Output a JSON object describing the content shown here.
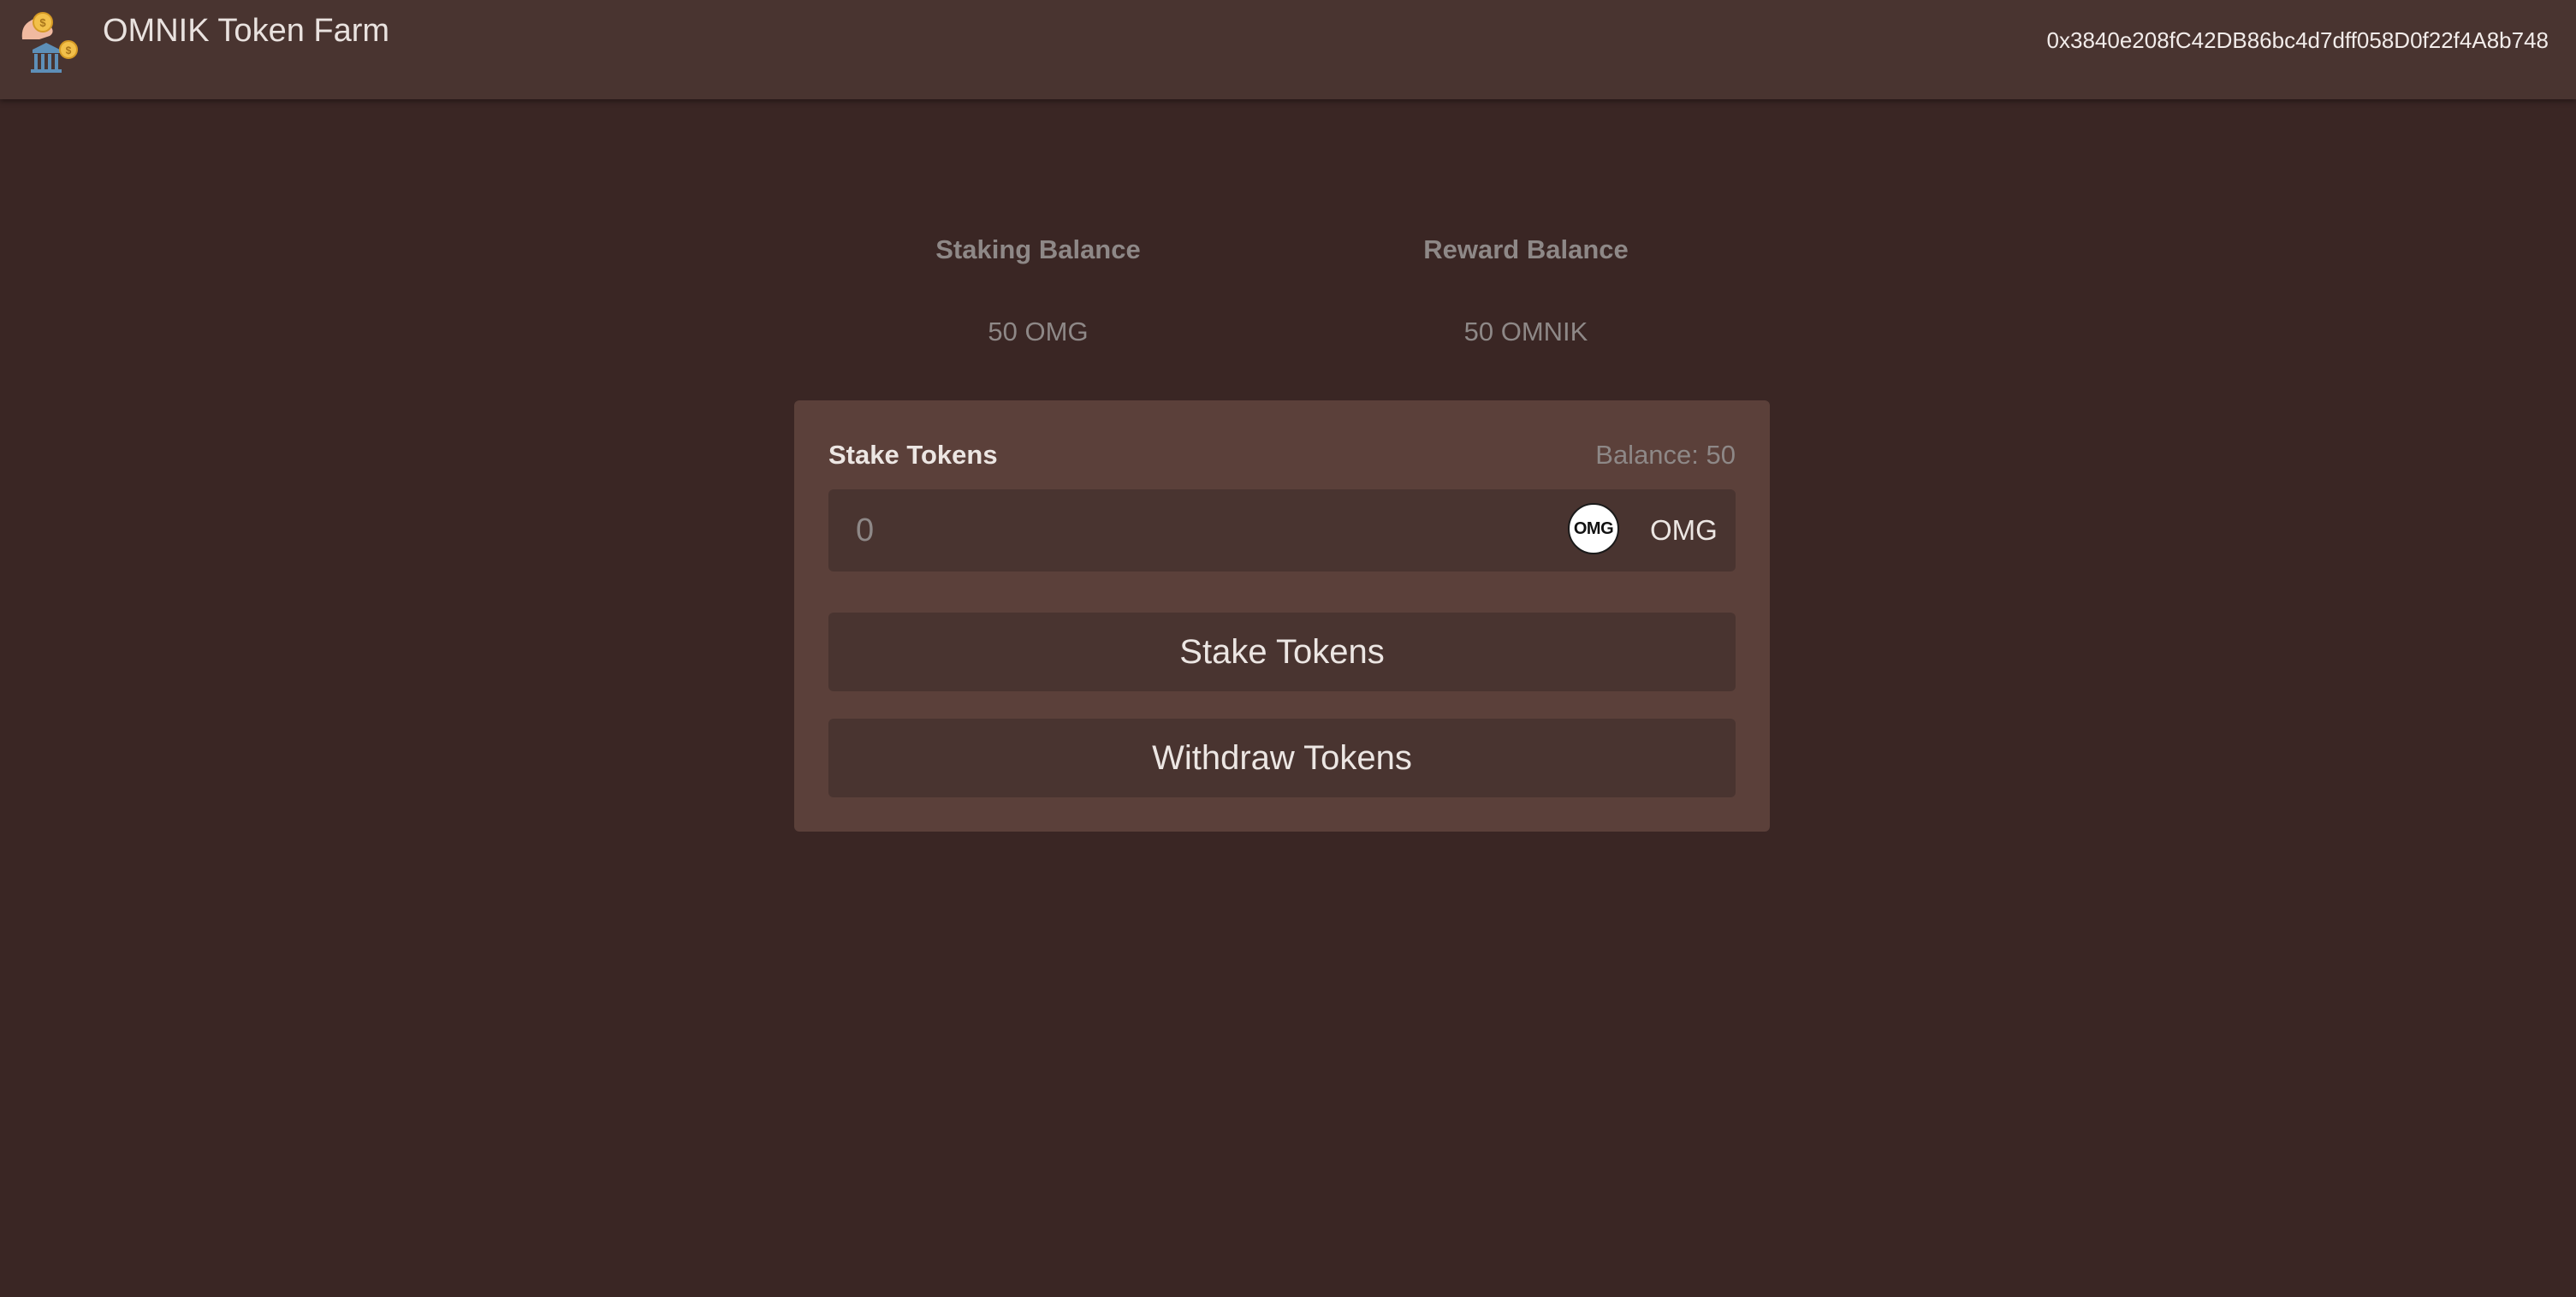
{
  "navbar": {
    "title": "OMNIK Token Farm",
    "account": "0x3840e208fC42DB86bc4d7dff058D0f22f4A8b748",
    "logo_icon": "token-farm-logo-icon"
  },
  "balances": {
    "staking_label": "Staking Balance",
    "staking_value": "50 OMG",
    "reward_label": "Reward Balance",
    "reward_value": "50 OMNIK"
  },
  "stake_form": {
    "title": "Stake Tokens",
    "balance": "Balance: 50",
    "amount_placeholder": "0",
    "token_icon_text": "OMG",
    "token_symbol": "OMG",
    "stake_button": "Stake Tokens",
    "withdraw_button": "Withdraw Tokens"
  },
  "colors": {
    "background": "#3a2624",
    "navbar": "#493430",
    "card": "#5b403a",
    "input": "#493430",
    "muted_text": "#8e8887"
  }
}
